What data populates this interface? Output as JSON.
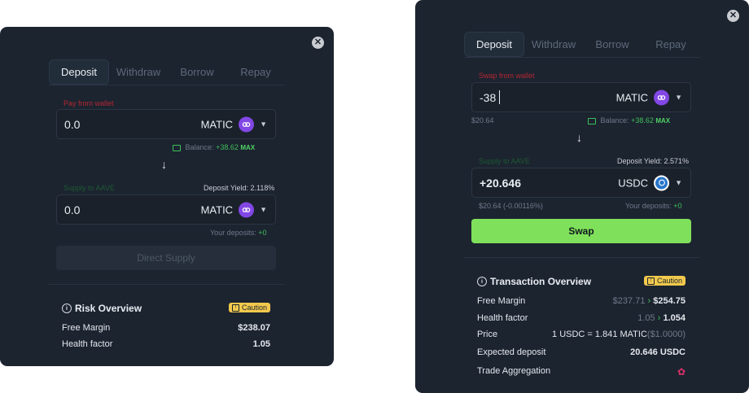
{
  "left": {
    "tabs": [
      "Deposit",
      "Withdraw",
      "Borrow",
      "Repay"
    ],
    "pay_label": "Pay from wallet",
    "pay_value": "0.0",
    "pay_token": "MATIC",
    "balance_label": "Balance:",
    "balance_value": "+38.62",
    "max_label": "MAX",
    "supply_label": "Supply to AAVE",
    "deposit_yield": "Deposit Yield: 2.118%",
    "supply_value": "0.0",
    "supply_token": "MATIC",
    "your_deposits_label": "Your deposits:",
    "your_deposits_value": "+0",
    "button": "Direct Supply",
    "overview_title": "Risk Overview",
    "caution": "Caution",
    "rows": [
      {
        "label": "Free Margin",
        "value": "$238.07"
      },
      {
        "label": "Health factor",
        "value": "1.05"
      }
    ]
  },
  "right": {
    "tabs": [
      "Deposit",
      "Withdraw",
      "Borrow",
      "Repay"
    ],
    "swap_label": "Swap from wallet",
    "swap_value": "-38",
    "swap_token": "MATIC",
    "usd_value": "$20.64",
    "balance_label": "Balance:",
    "balance_value": "+38.62",
    "max_label": "MAX",
    "supply_label": "Supply to AAVE",
    "deposit_yield": "Deposit Yield: 2.571%",
    "supply_value": "+20.646",
    "supply_token": "USDC",
    "supply_usd": "$20.64 (-0.00116%)",
    "your_deposits_label": "Your deposits:",
    "your_deposits_value": "+0",
    "button": "Swap",
    "overview_title": "Transaction Overview",
    "caution": "Caution",
    "free_margin_label": "Free Margin",
    "free_margin_old": "$237.71",
    "free_margin_new": "$254.75",
    "health_label": "Health factor",
    "health_old": "1.05",
    "health_new": "1.054",
    "price_label": "Price",
    "price_value": "1 USDC = 1.841 MATIC",
    "price_usd": "($1.0000)",
    "expected_label": "Expected deposit",
    "expected_value": "20.646 USDC",
    "agg_label": "Trade Aggregation"
  },
  "colors": {
    "accent_green": "#7fe15b",
    "panel": "#1c2430",
    "caution": "#f2c94c",
    "matic": "#8247e5",
    "usdc": "#2775ca"
  },
  "icons": [
    "close-icon",
    "wallet-icon",
    "arrow-down-icon",
    "chevron-down-icon",
    "info-icon",
    "caution-icon",
    "matic-icon",
    "usdc-icon",
    "aggregation-icon"
  ]
}
